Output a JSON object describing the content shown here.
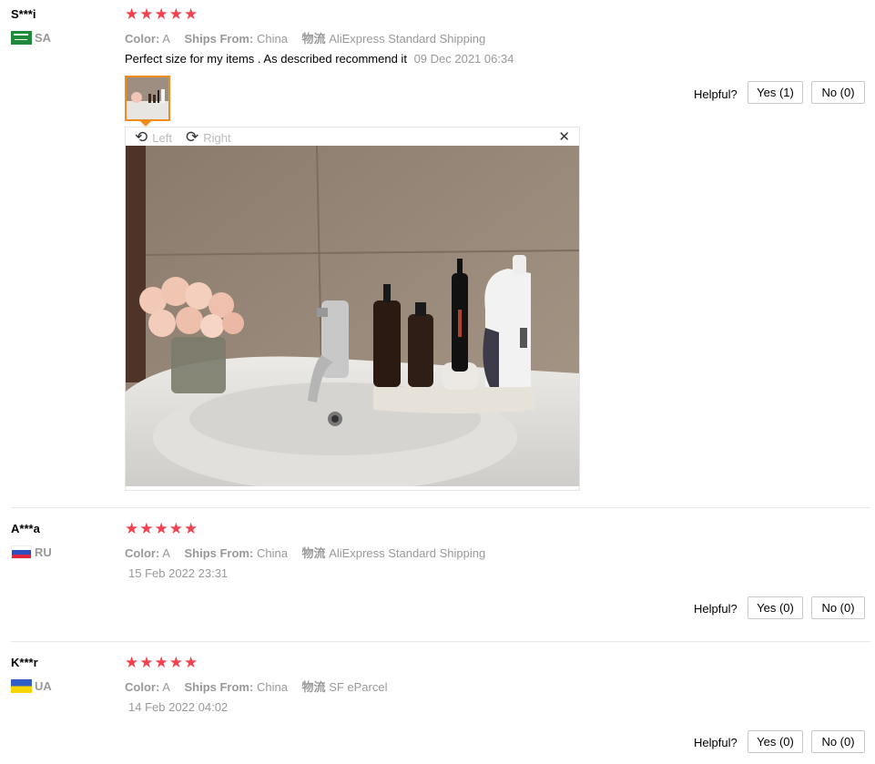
{
  "reviews": [
    {
      "user": "S***i",
      "country_code": "SA",
      "color_label": "Color:",
      "color_value": "A",
      "ships_label": "Ships From:",
      "ships_value": "China",
      "logistics_label": "物流",
      "logistics_value": "AliExpress Standard Shipping",
      "text": "Perfect size for my items . As described recommend it",
      "date": "09 Dec 2021 06:34",
      "helpful_label": "Helpful?",
      "yes_label": "Yes (1)",
      "no_label": "No (0)",
      "rating": 5
    },
    {
      "user": "A***a",
      "country_code": "RU",
      "color_label": "Color:",
      "color_value": "A",
      "ships_label": "Ships From:",
      "ships_value": "China",
      "logistics_label": "物流",
      "logistics_value": "AliExpress Standard Shipping",
      "date": "15 Feb 2022 23:31",
      "helpful_label": "Helpful?",
      "yes_label": "Yes (0)",
      "no_label": "No (0)",
      "rating": 5
    },
    {
      "user": "K***r",
      "country_code": "UA",
      "color_label": "Color:",
      "color_value": "A",
      "ships_label": "Ships From:",
      "ships_value": "China",
      "logistics_label": "物流",
      "logistics_value": "SF eParcel",
      "date": "14 Feb 2022 04:02",
      "helpful_label": "Helpful?",
      "yes_label": "Yes (0)",
      "no_label": "No (0)",
      "rating": 5
    }
  ],
  "viewer": {
    "rotate_left_label": "Left",
    "rotate_right_label": "Right",
    "rotate_left_icon": "rotate-left-icon",
    "rotate_right_icon": "rotate-right-icon",
    "close_icon": "close-icon"
  },
  "colors": {
    "star": "#f0434f",
    "muted_text": "#999999",
    "thumb_border": "#f08c1d"
  }
}
